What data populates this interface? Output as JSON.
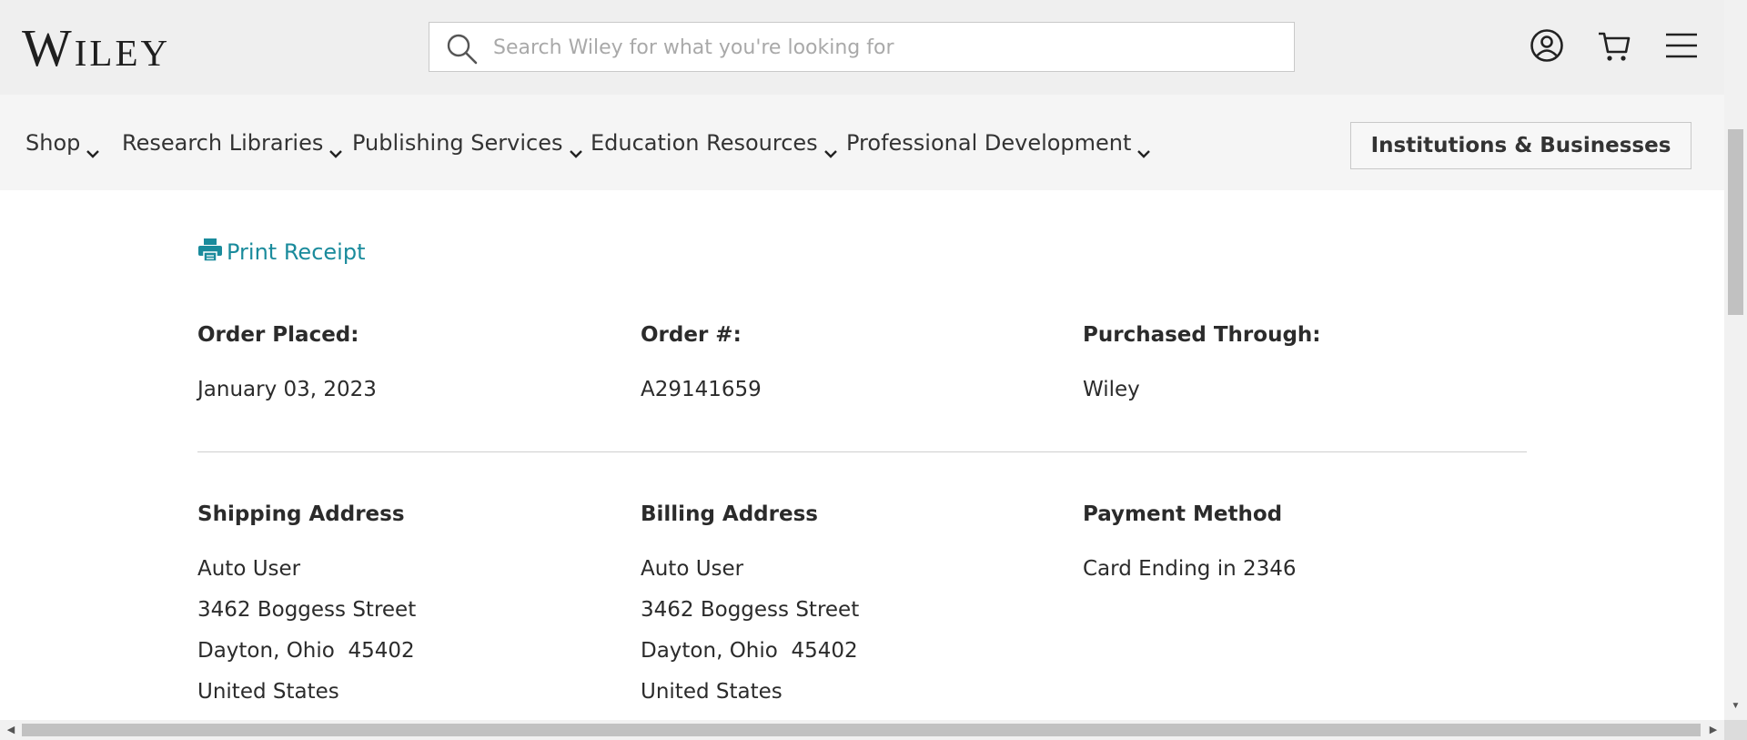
{
  "header": {
    "logo": "Wiley",
    "search_placeholder": "Search Wiley for what you're looking for",
    "icons": [
      "account-icon",
      "cart-icon",
      "menu-icon"
    ]
  },
  "nav": {
    "items": [
      {
        "label": "Shop"
      },
      {
        "label": "Research Libraries"
      },
      {
        "label": "Publishing Services"
      },
      {
        "label": "Education Resources"
      },
      {
        "label": "Professional Development"
      }
    ],
    "button": "Institutions & Businesses"
  },
  "receipt": {
    "print_label": "Print Receipt",
    "order_placed_label": "Order Placed:",
    "order_placed_value": "January 03, 2023",
    "order_number_label": "Order #:",
    "order_number_value": "A29141659",
    "purchased_through_label": "Purchased Through:",
    "purchased_through_value": "Wiley",
    "shipping": {
      "label": "Shipping Address",
      "name": "Auto User",
      "street": "3462 Boggess Street",
      "city_line": "Dayton, Ohio  45402",
      "country": "United States"
    },
    "billing": {
      "label": "Billing Address",
      "name": "Auto User",
      "street": "3462 Boggess Street",
      "city_line": "Dayton, Ohio  45402",
      "country": "United States"
    },
    "payment": {
      "label": "Payment Method",
      "value": "Card Ending in 2346"
    }
  },
  "colors": {
    "accent": "#1a8b9c",
    "header_bg": "#efefef",
    "nav_bg": "#f5f5f5",
    "text": "#2b2b2b"
  }
}
